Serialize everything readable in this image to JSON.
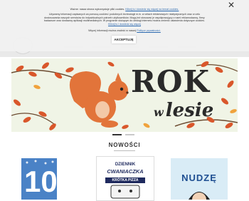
{
  "cookie": {
    "line1_text": "Ważne: nasza strona wykorzystuje pliki cookies.",
    "line1_link": "Kliknij tu i dowiedz się więcej na temat cookies.",
    "para": "Używamy informacji zapisanych za pomocą cookies i podobnych technologii m.in. w celach reklamowych i statystycznych oraz w celu dostosowania naszych serwisów do indywidualnych potrzeb użytkowników. Mogą też stosować je współpracujący z nami reklamodawcy, firmy badawcze oraz dostawcy aplikacji multimedialnych. W programie służącym do obsługi internetu można zmienić ustawienia dotyczące cookies.",
    "para_link": "Kliknij tu i dowiedz się więcej",
    "line3_text": "Więcej informacji można znaleźć w naszej",
    "line3_link": "Polityce prywatności.",
    "accept_label": "AKCEPTUJĘ",
    "close_glyph": "✕"
  },
  "hero": {
    "title": "ROK",
    "subtitle_small": "w",
    "subtitle": "lesie"
  },
  "new_section": {
    "title": "NOWOŚCI"
  },
  "books": [
    {
      "title_line1": "10"
    },
    {
      "title_line1": "DZIENNIK",
      "title_line2": "CWANIACZKA",
      "title_line3": "KRÓTKA PIZZA"
    },
    {
      "title_line1": "NUDZĘ"
    }
  ],
  "colors": {
    "hero_bg": "#f0f4e6",
    "squirrel": "#e2743a",
    "leaves": "#d9572b",
    "link": "#2c6ab0"
  }
}
